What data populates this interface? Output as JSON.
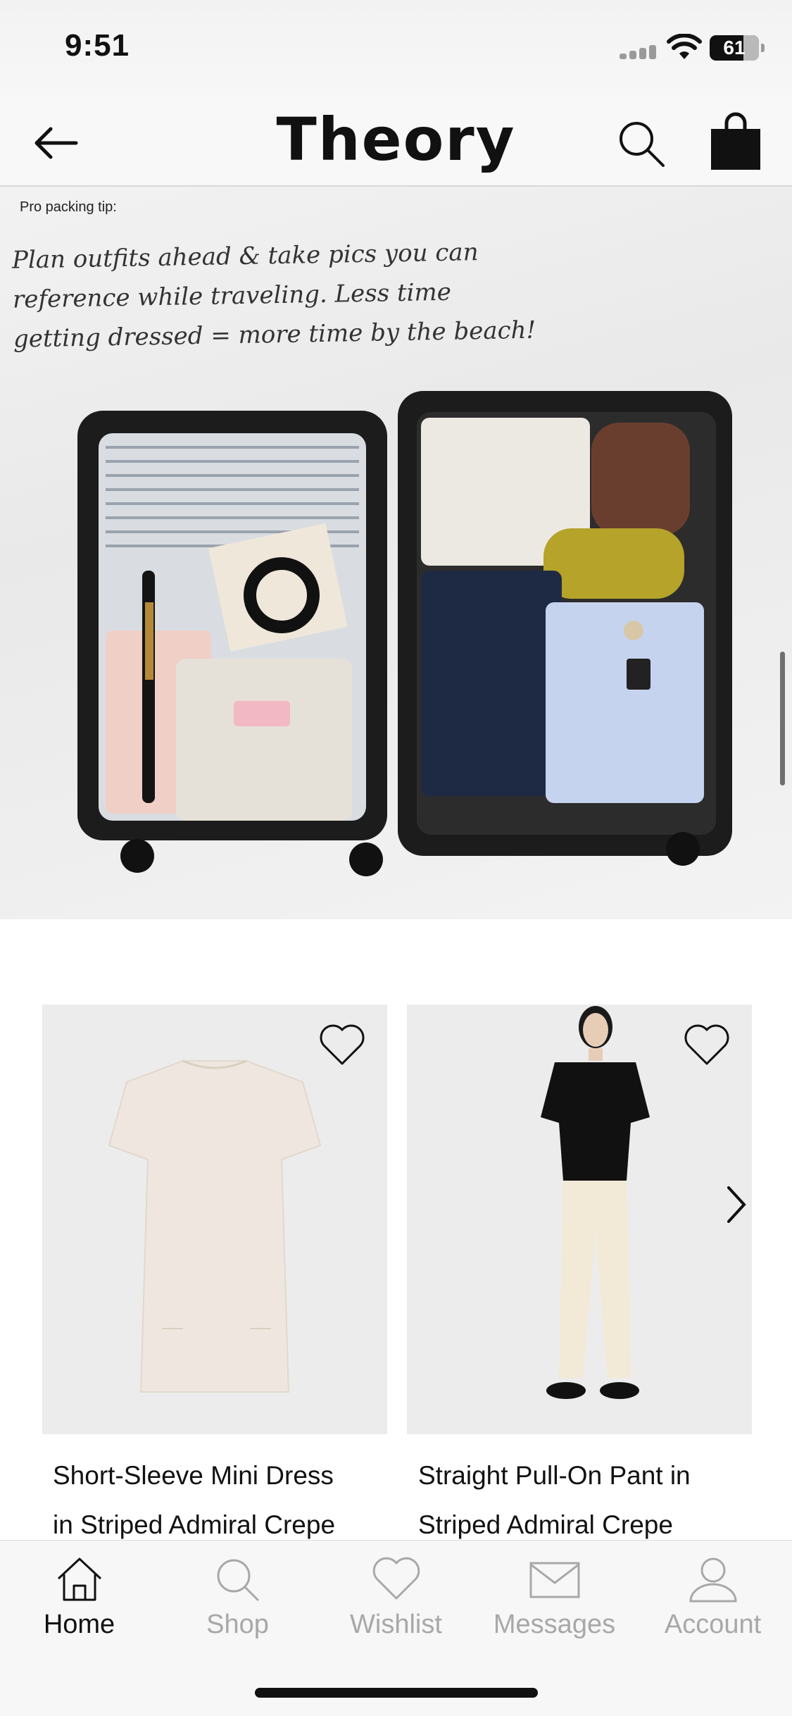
{
  "status": {
    "time": "9:51",
    "battery": "61"
  },
  "header": {
    "brand": "Theory"
  },
  "hero": {
    "tip_label": "Pro packing tip:",
    "handwriting": [
      "Plan outfits ahead & take pics you can",
      "reference while traveling. Less time",
      "getting dressed = more time by the beach!"
    ]
  },
  "products": [
    {
      "title_line1": "Short-Sleeve Mini Dress",
      "title_line2": "in Striped Admiral Crepe"
    },
    {
      "title_line1": "Straight Pull-On Pant in",
      "title_line2": "Striped Admiral Crepe"
    }
  ],
  "tabs": [
    {
      "label": "Home",
      "icon": "home-icon",
      "active": true
    },
    {
      "label": "Shop",
      "icon": "search-icon",
      "active": false
    },
    {
      "label": "Wishlist",
      "icon": "heart-icon",
      "active": false
    },
    {
      "label": "Messages",
      "icon": "envelope-icon",
      "active": false
    },
    {
      "label": "Account",
      "icon": "person-icon",
      "active": false
    }
  ]
}
